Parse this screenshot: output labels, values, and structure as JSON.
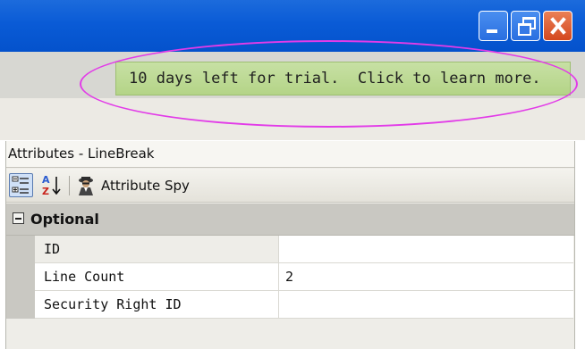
{
  "window": {
    "controls": {
      "minimize_icon": "minimize-icon",
      "maximize_icon": "restore-icon",
      "close_icon": "close-icon"
    }
  },
  "trial_banner": {
    "text": "10 days left for trial.  Click to learn more.",
    "highlight_color": "#e23be8"
  },
  "panel": {
    "title": "Attributes - LineBreak",
    "toolbar": {
      "categorized_icon": "categorized-view-icon",
      "alphabetical_icon": "sort-az-icon",
      "attribute_spy_label": "Attribute Spy",
      "attribute_spy_icon": "spy-icon"
    },
    "group": {
      "label": "Optional",
      "state": "expanded"
    },
    "properties": [
      {
        "name": "ID",
        "value": ""
      },
      {
        "name": "Line Count",
        "value": "2"
      },
      {
        "name": "Security Right ID",
        "value": ""
      }
    ]
  },
  "colors": {
    "titlebar": "#0a5bd6",
    "trial_bg": "#b4d487",
    "group_bg": "#c9c8c2"
  }
}
